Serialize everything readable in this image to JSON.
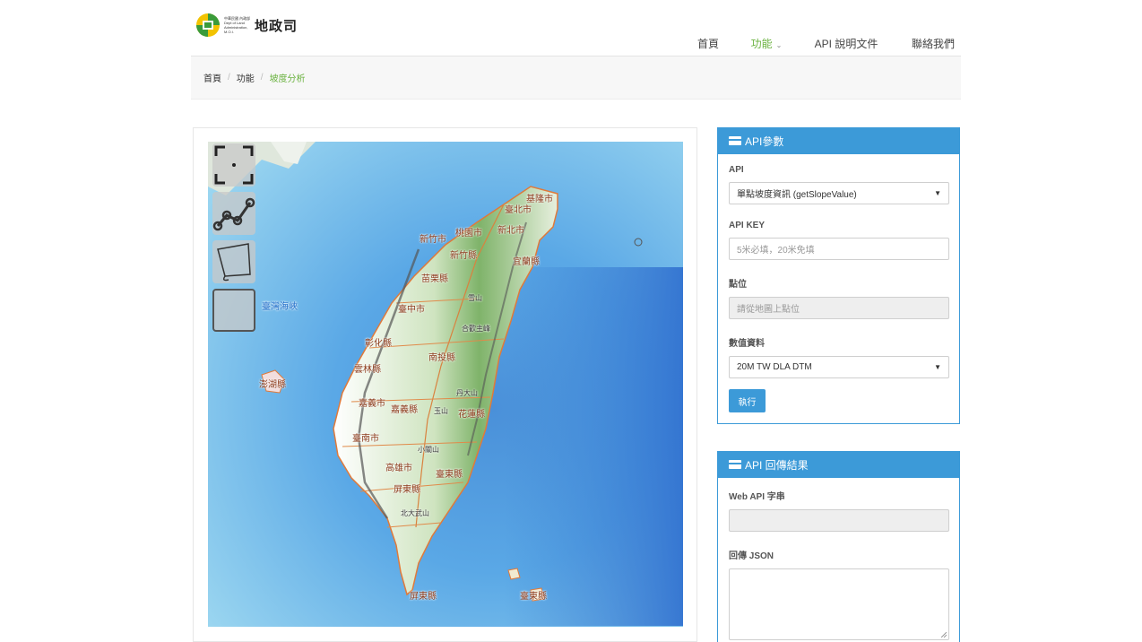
{
  "header": {
    "logo_small": "中華民國 內政部 Dept of Land Administration, M.O.I.",
    "logo_title": "地政司",
    "nav": [
      {
        "label": "首頁",
        "active": false
      },
      {
        "label": "功能",
        "active": true
      },
      {
        "label": "API 說明文件",
        "active": false
      },
      {
        "label": "聯絡我們",
        "active": false
      }
    ]
  },
  "breadcrumb": [
    "首頁",
    "功能",
    "坡度分析"
  ],
  "map": {
    "labels": {
      "strait": "臺灣海峽",
      "keelung": "基隆市",
      "taipei": "臺北市",
      "newtaipei": "新北市",
      "taoyuan": "桃園市",
      "hsinchu_city": "新竹市",
      "hsinchu": "新竹縣",
      "yilan": "宜蘭縣",
      "miaoli": "苗栗縣",
      "xueshan": "雪山",
      "taichung": "臺中市",
      "hehuan": "合歡主峰",
      "changhua": "彰化縣",
      "nantou": "南投縣",
      "yunlin": "雲林縣",
      "penghu": "澎湖縣",
      "chiayi_city": "嘉義市",
      "chiayi": "嘉義縣",
      "yushan": "玉山",
      "yuedashan": "丹大山",
      "hualien": "花蓮縣",
      "tainan": "臺南市",
      "xiaoguanshan": "小關山",
      "kaohsiung": "高雄市",
      "taitung": "臺東縣",
      "pingtung": "屏東縣",
      "beidawu": "北大武山",
      "pingtung2": "屏東縣",
      "taitung2": "臺東縣"
    }
  },
  "api_panel": {
    "title": "API參數",
    "api_label": "API",
    "api_value": "單點坡度資訊 (getSlopeValue)",
    "key_label": "API KEY",
    "key_placeholder": "5米必填，20米免填",
    "point_label": "點位",
    "point_placeholder": "請從地圖上點位",
    "data_label": "數值資料",
    "data_value": "20M TW DLA DTM",
    "run_label": "執行"
  },
  "result_panel": {
    "title": "API 回傳結果",
    "url_label": "Web API 字串",
    "json_label": "回傳 JSON"
  },
  "colors": {
    "accent_green": "#6ab23f",
    "panel_blue": "#3c9ad8"
  }
}
